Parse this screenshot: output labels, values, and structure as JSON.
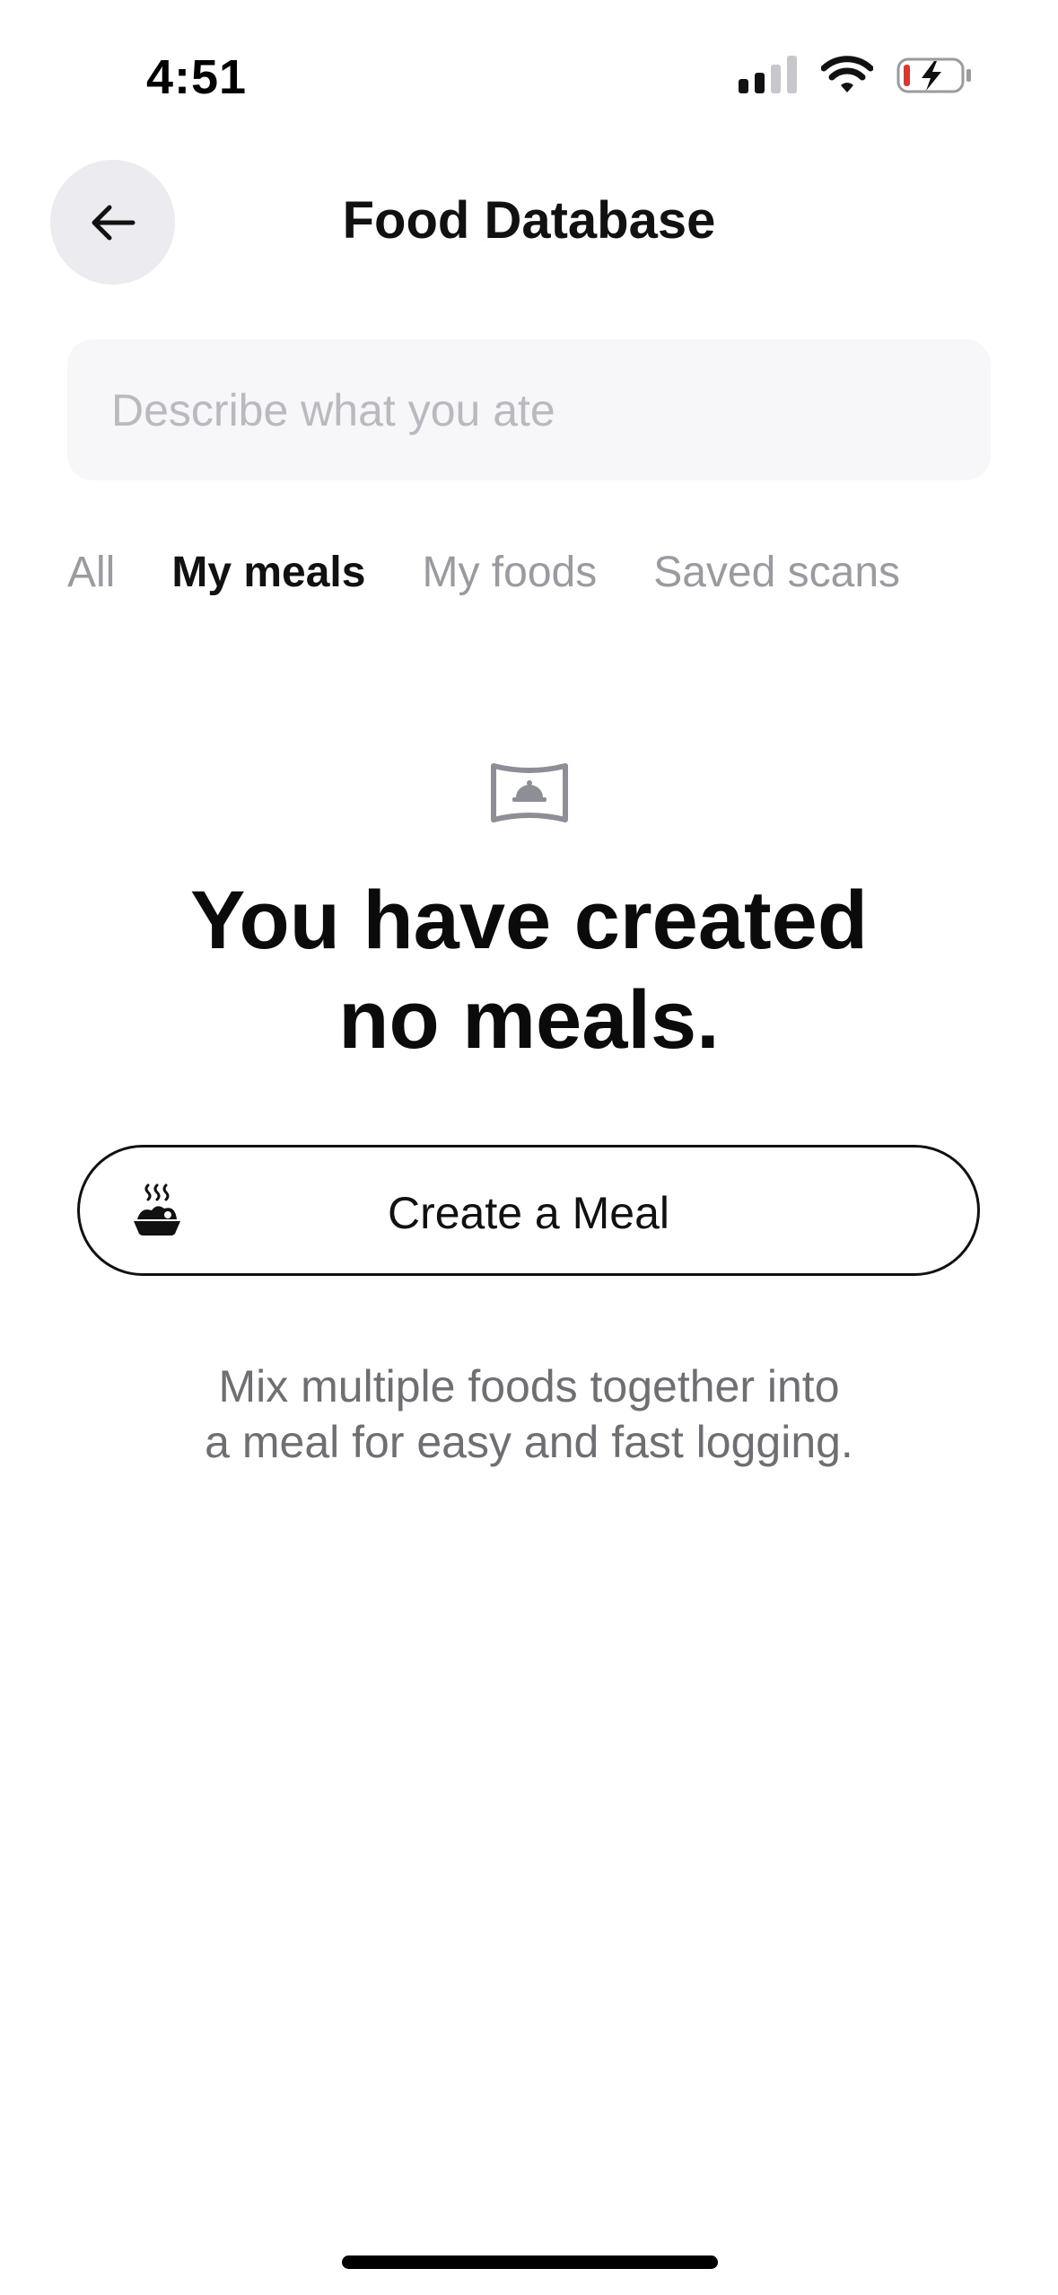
{
  "status_bar": {
    "time": "4:51",
    "icons": [
      "cellular-signal-icon",
      "wifi-icon",
      "battery-charging-icon"
    ],
    "battery_color": "#e5322d"
  },
  "header": {
    "title": "Food Database",
    "back_icon": "arrow-left-icon"
  },
  "search": {
    "placeholder": "Describe what you ate",
    "value": ""
  },
  "tabs": [
    {
      "label": "All",
      "active": false
    },
    {
      "label": "My meals",
      "active": true
    },
    {
      "label": "My foods",
      "active": false
    },
    {
      "label": "Saved scans",
      "active": false
    }
  ],
  "empty_state": {
    "icon": "meal-placeholder-icon",
    "title_line1": "You have created",
    "title_line2": "no meals.",
    "button_label": "Create a Meal",
    "button_icon": "hot-meal-icon",
    "desc_line1": "Mix multiple foods together into",
    "desc_line2": "a meal for easy and fast logging."
  }
}
